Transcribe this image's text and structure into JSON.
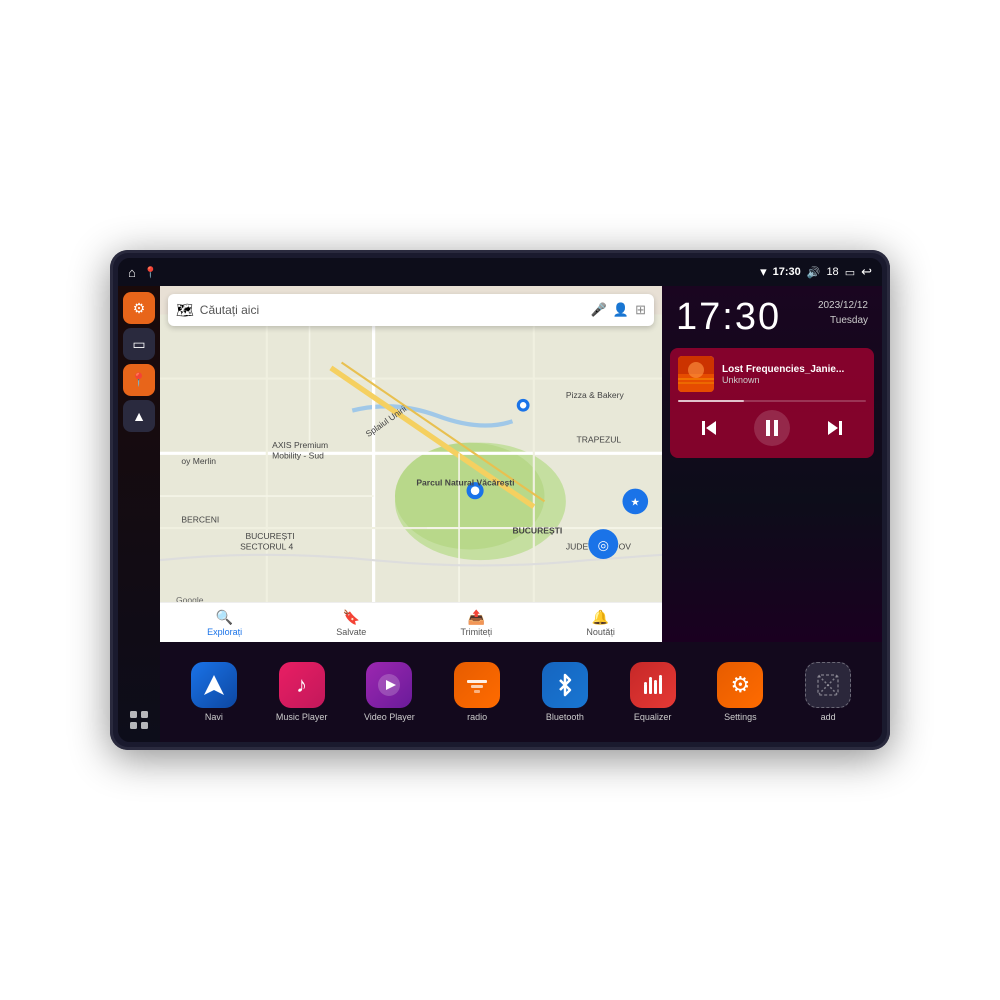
{
  "device": {
    "status_bar": {
      "left_icons": [
        "home",
        "location"
      ],
      "wifi_icon": "▾",
      "time": "17:30",
      "volume_icon": "🔊",
      "battery_level": "18",
      "battery_icon": "🔋",
      "back_icon": "↩"
    },
    "clock": {
      "time": "17:30",
      "date": "2023/12/12",
      "day": "Tuesday"
    },
    "music": {
      "title": "Lost Frequencies_Janie...",
      "artist": "Unknown",
      "album_art": "🎵"
    },
    "map": {
      "search_placeholder": "Căutați aici",
      "locations": [
        "AXIS Premium Mobility - Sud",
        "Pizza & Bakery",
        "TRAPEZUL",
        "Parcul Natural Văcărești",
        "BUCUREȘTI",
        "BUCUREȘTI SECTORUL 4",
        "JUDEȚUL ILFOV",
        "BERCENI",
        "oy Merlin"
      ],
      "bottom_items": [
        {
          "label": "Explorați",
          "icon": "🔍",
          "active": true
        },
        {
          "label": "Salvate",
          "icon": "🔖",
          "active": false
        },
        {
          "label": "Trimiteți",
          "icon": "📤",
          "active": false
        },
        {
          "label": "Noutăți",
          "icon": "🔔",
          "active": false
        }
      ]
    },
    "apps": [
      {
        "id": "navi",
        "label": "Navi",
        "icon_class": "icon-navi",
        "symbol": "▲"
      },
      {
        "id": "music-player",
        "label": "Music Player",
        "icon_class": "icon-music",
        "symbol": "♪"
      },
      {
        "id": "video-player",
        "label": "Video Player",
        "icon_class": "icon-video",
        "symbol": "▶"
      },
      {
        "id": "radio",
        "label": "radio",
        "icon_class": "icon-radio",
        "symbol": "📻"
      },
      {
        "id": "bluetooth",
        "label": "Bluetooth",
        "icon_class": "icon-bt",
        "symbol": "ᛒ"
      },
      {
        "id": "equalizer",
        "label": "Equalizer",
        "icon_class": "icon-eq",
        "symbol": "🎚"
      },
      {
        "id": "settings",
        "label": "Settings",
        "icon_class": "icon-settings",
        "symbol": "⚙"
      },
      {
        "id": "add",
        "label": "add",
        "icon_class": "icon-add",
        "symbol": "+"
      }
    ],
    "sidebar": [
      {
        "id": "settings",
        "icon": "⚙",
        "color": "orange"
      },
      {
        "id": "files",
        "icon": "📁",
        "color": "dark"
      },
      {
        "id": "map",
        "icon": "📍",
        "color": "orange"
      },
      {
        "id": "nav",
        "icon": "▲",
        "color": "dark"
      }
    ]
  }
}
